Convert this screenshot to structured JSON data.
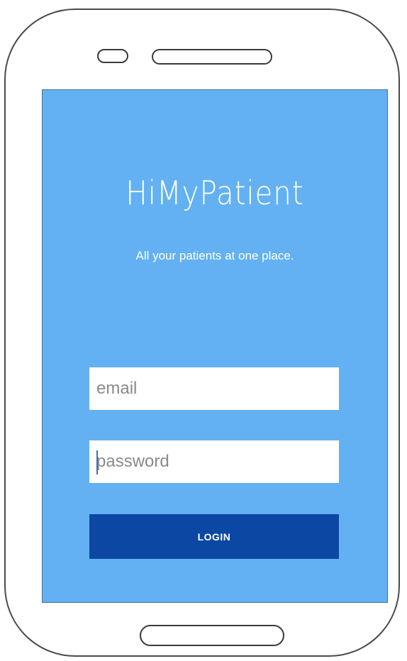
{
  "app": {
    "title": "HiMyPatient",
    "tagline": "All your patients at one place."
  },
  "login_form": {
    "email_placeholder": "email",
    "email_value": "",
    "password_placeholder": "password",
    "password_value": "",
    "login_label": "LOGIN"
  },
  "colors": {
    "screen_background": "#63b1f2",
    "button_background": "#0c48a3",
    "text": "#ffffff"
  }
}
